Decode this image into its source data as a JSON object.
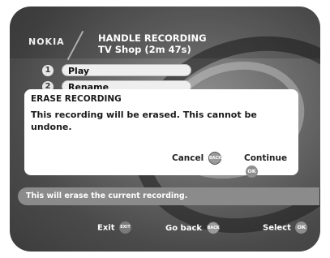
{
  "brand": "NOKIA",
  "header": {
    "title": "HANDLE RECORDING",
    "subtitle": "TV Shop (2m 47s)"
  },
  "menu": {
    "items": [
      {
        "number": "1",
        "label": "Play"
      },
      {
        "number": "2",
        "label": "Rename"
      }
    ]
  },
  "dialog": {
    "title": "ERASE RECORDING",
    "message": "This recording will be erased. This cannot be undone.",
    "cancel_label": "Cancel",
    "cancel_key": "BACK",
    "continue_label": "Continue",
    "continue_key": "OK"
  },
  "status_message": "This will erase the current recording.",
  "footer": {
    "exit_label": "Exit",
    "exit_key": "EXIT",
    "go_back_label": "Go back",
    "go_back_key": "BACK",
    "select_label": "Select",
    "select_key": "OK"
  },
  "icons": {
    "back_key": "back-key-icon",
    "ok_key": "ok-key-icon",
    "exit_key": "exit-key-icon"
  }
}
